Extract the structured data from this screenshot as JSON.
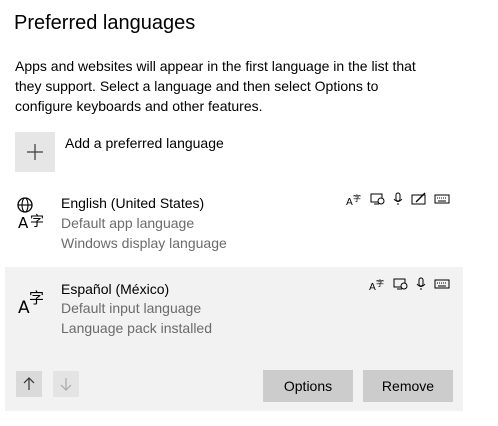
{
  "title": "Preferred languages",
  "description_lines": [
    "Apps and websites will appear in the first language in the list that",
    "they support. Select a language and then select Options to",
    "configure keyboards and other features."
  ],
  "add_language": {
    "label": "Add a preferred language",
    "icon": "plus-icon"
  },
  "languages": [
    {
      "name": "English (United States)",
      "details": [
        "Default app language",
        "Windows display language"
      ],
      "features": [
        "text-to-speech-icon",
        "display-language-icon",
        "speech-recognition-icon",
        "handwriting-icon",
        "keyboard-icon"
      ],
      "selected": false
    },
    {
      "name": "Español (México)",
      "details": [
        "Default input language",
        "Language pack installed"
      ],
      "features": [
        "text-to-speech-icon",
        "display-language-icon",
        "speech-recognition-icon",
        "keyboard-icon"
      ],
      "selected": true
    }
  ],
  "buttons": {
    "options": "Options",
    "remove": "Remove",
    "move_up": "arrow-up-icon",
    "move_down": "arrow-down-icon"
  },
  "colors": {
    "button_bg": "#cccccc",
    "selected_bg": "#f2f2f2",
    "secondary_text": "#6b6b6b"
  }
}
